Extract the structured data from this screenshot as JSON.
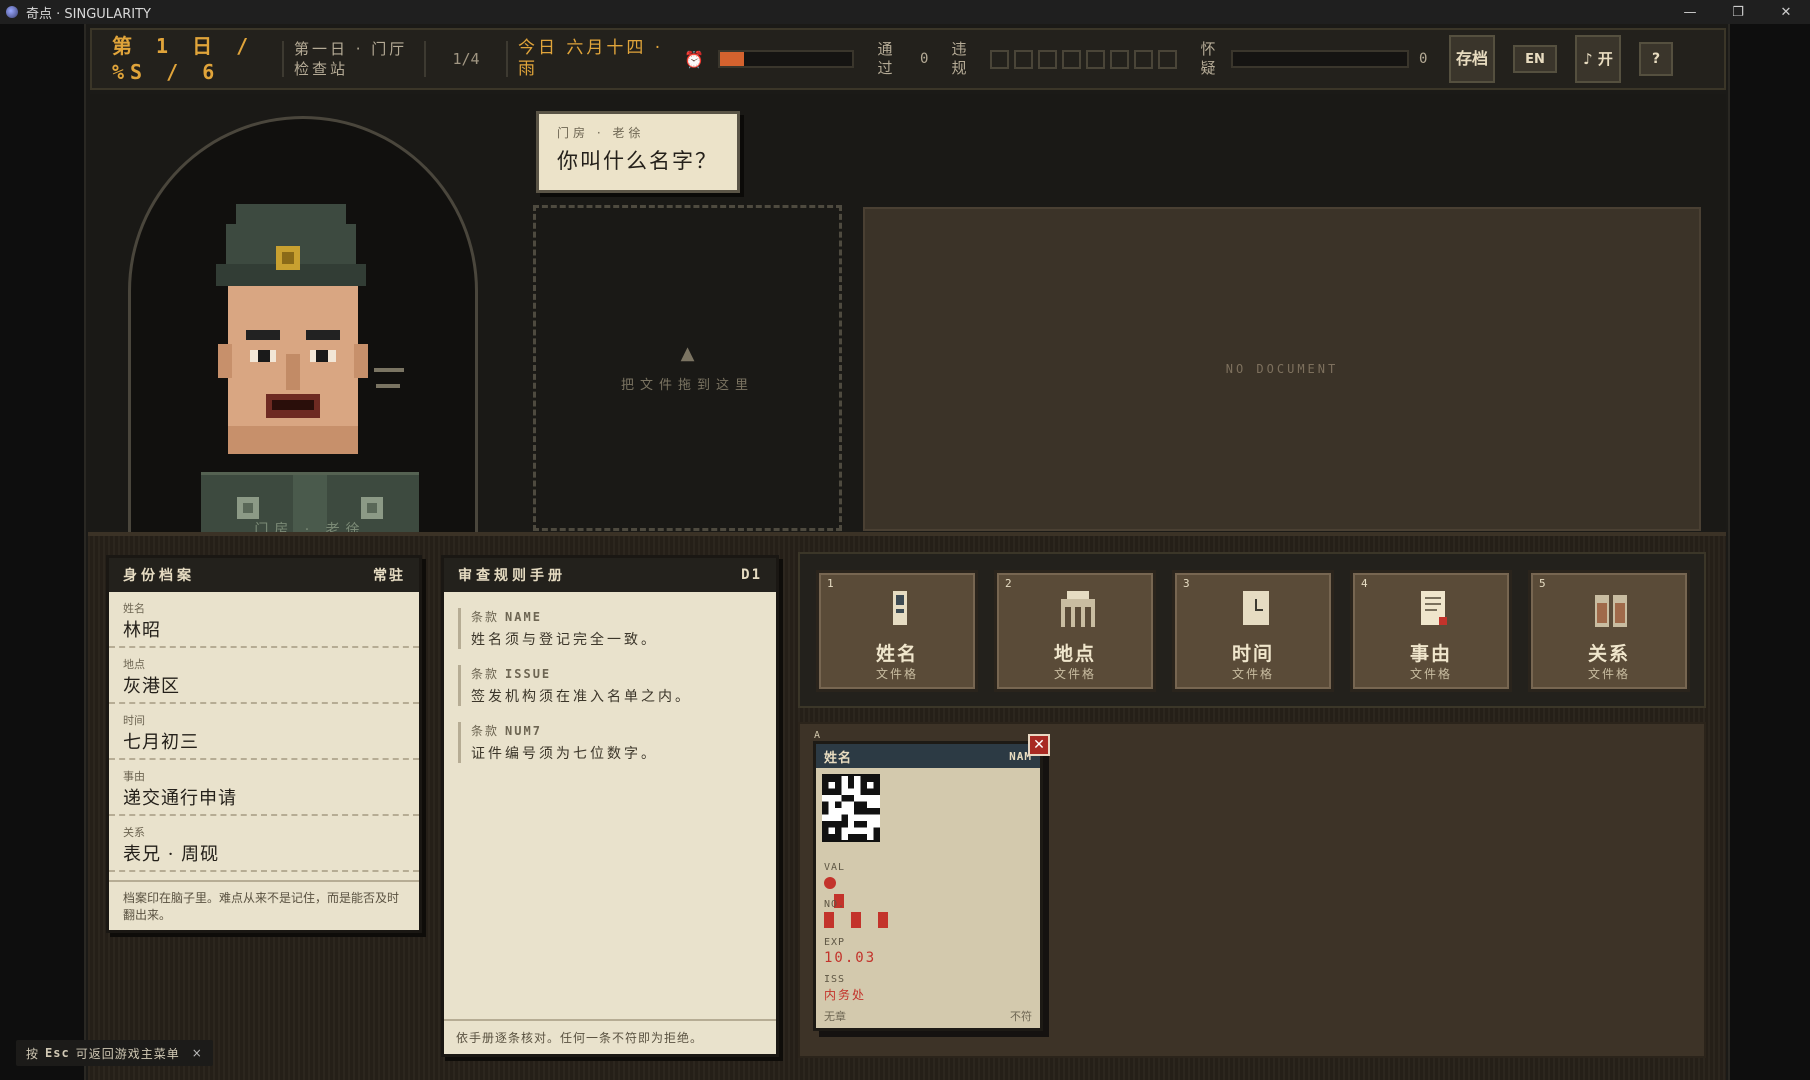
{
  "window": {
    "title": "奇点 · SINGULARITY",
    "min": "—",
    "max": "❐",
    "close": "✕"
  },
  "hud": {
    "day_line1": "第 1 日 /",
    "day_line2": "%S / 6",
    "station": "第一日 · 门厅检查站",
    "count": "1/4",
    "date": "今日 六月十四 · 雨",
    "clock_icon": "alarm-clock-icon",
    "time_progress": 0.18,
    "pass_label": "通过",
    "pass_count": "0",
    "violation_label": "违规",
    "violation_slots": 8,
    "suspicion_label": "怀疑",
    "suspicion_value": "0",
    "suspicion_progress": 0,
    "save_label": "存档",
    "lang_label": "EN",
    "music_label": "♪ 开",
    "help_label": "?"
  },
  "booth": {
    "npc_tag": "门房 · 老徐"
  },
  "speech": {
    "speaker": "门房 · 老徐",
    "line": "你叫什么名字？"
  },
  "dropzone": {
    "arrow": "▲",
    "hint": "把文件拖到这里"
  },
  "docview": {
    "empty": "NO DOCUMENT"
  },
  "profile": {
    "title": "身份档案",
    "badge": "常驻",
    "fields": [
      {
        "k": "姓名",
        "v": "林昭"
      },
      {
        "k": "地点",
        "v": "灰港区"
      },
      {
        "k": "时间",
        "v": "七月初三"
      },
      {
        "k": "事由",
        "v": "递交通行申请"
      },
      {
        "k": "关系",
        "v": "表兄 · 周砚"
      }
    ],
    "note": "档案印在脑子里。难点从来不是记住，而是能否及时翻出来。"
  },
  "rules": {
    "title": "审查规则手册",
    "badge": "D1",
    "items": [
      {
        "k": "条款",
        "code": "NAME",
        "t": "姓名须与登记完全一致。"
      },
      {
        "k": "条款",
        "code": "ISSUE",
        "t": "签发机构须在准入名单之内。"
      },
      {
        "k": "条款",
        "code": "NUM7",
        "t": "证件编号须为七位数字。"
      }
    ],
    "foot": "依手册逐条核对。任何一条不符即为拒绝。"
  },
  "tray": [
    {
      "n": "1",
      "t": "姓名",
      "s": "文件格"
    },
    {
      "n": "2",
      "t": "地点",
      "s": "文件格"
    },
    {
      "n": "3",
      "t": "时间",
      "s": "文件格"
    },
    {
      "n": "4",
      "t": "事由",
      "s": "文件格"
    },
    {
      "n": "5",
      "t": "关系",
      "s": "文件格"
    }
  ],
  "card": {
    "tab": "A",
    "title": "姓名",
    "code": "NAM",
    "val_label": "VAL",
    "no_label": "NO.",
    "exp_label": "EXP",
    "exp_value": "10.03",
    "iss_label": "ISS",
    "iss_value": "内务处",
    "foot_left": "无章",
    "foot_right": "不符",
    "close": "✕"
  },
  "esc": {
    "pre": "按",
    "key": "Esc",
    "post": "可返回游戏主菜单",
    "close": "×"
  },
  "colors": {
    "accent": "#e0a43a",
    "danger": "#c3332b",
    "paper": "#e9e2cc"
  }
}
